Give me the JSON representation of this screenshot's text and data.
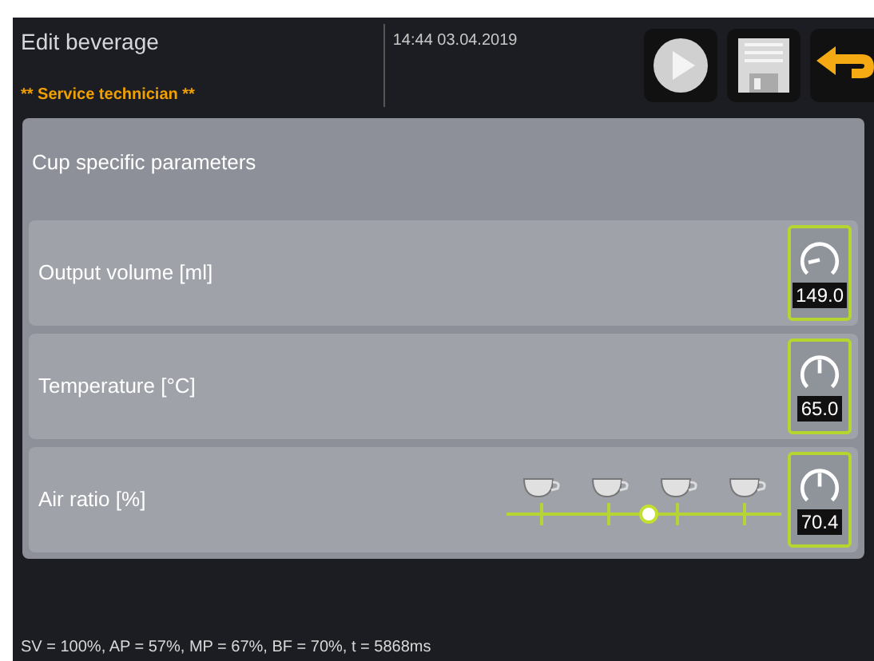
{
  "header": {
    "title": "Edit beverage",
    "user_role": "** Service technician **",
    "datetime": "14:44 03.04.2019"
  },
  "panel": {
    "title": "Cup specific parameters",
    "rows": [
      {
        "kind": "plain",
        "label": "Output volume [ml]",
        "value": "149.0",
        "dial": {
          "kind": "left"
        }
      },
      {
        "kind": "plain",
        "label": "Temperature [°C]",
        "value": "65.0",
        "dial": {
          "kind": "up"
        }
      },
      {
        "kind": "slider",
        "label": "Air ratio [%]",
        "value": "70.4",
        "dial": {
          "kind": "up"
        },
        "level": 0.52
      }
    ]
  },
  "status_bar": "SV = 100%, AP = 57%, MP = 67%, BF = 70%, t = 5868ms"
}
